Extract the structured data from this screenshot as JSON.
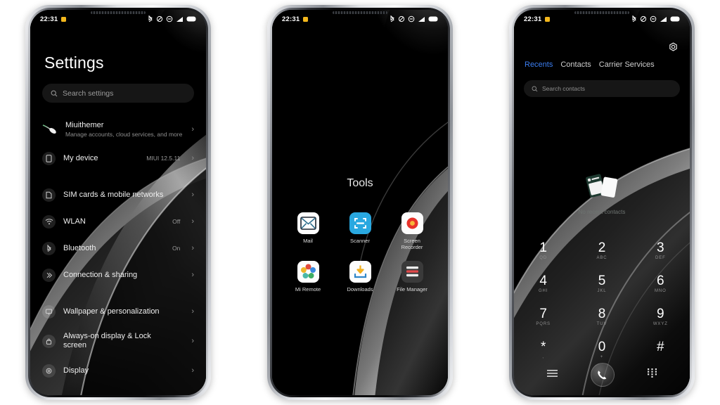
{
  "statusbar": {
    "time": "22:31",
    "icons": [
      "bluetooth-icon",
      "vibrate-off-icon",
      "dnd-icon",
      "signal-icon",
      "battery-icon"
    ]
  },
  "phone1": {
    "name": "settings-screen",
    "title": "Settings",
    "search": {
      "placeholder": "Search settings",
      "icon": "search-icon"
    },
    "account": {
      "name": "Miuithemer",
      "subtitle": "Manage accounts, cloud services, and more",
      "icon": "comet-avatar-icon",
      "chevron": "›"
    },
    "items": [
      {
        "label": "My device",
        "value": "MIUI 12.5.11",
        "icon": "phone-icon",
        "chevron": "›"
      },
      {
        "label": "SIM cards & mobile networks",
        "value": "",
        "icon": "sim-icon",
        "chevron": "›"
      },
      {
        "label": "WLAN",
        "value": "Off",
        "icon": "wifi-icon",
        "chevron": "›"
      },
      {
        "label": "Bluetooth",
        "value": "On",
        "icon": "bluetooth-icon",
        "chevron": "›"
      },
      {
        "label": "Connection & sharing",
        "value": "",
        "icon": "sharing-icon",
        "chevron": "›"
      },
      {
        "label": "Wallpaper & personalization",
        "value": "",
        "icon": "wallpaper-icon",
        "chevron": "›"
      },
      {
        "label": "Always-on display & Lock screen",
        "value": "",
        "icon": "lock-icon",
        "chevron": "›"
      },
      {
        "label": "Display",
        "value": "",
        "icon": "display-icon",
        "chevron": "›"
      }
    ]
  },
  "phone2": {
    "name": "tools-folder-screen",
    "folder_title": "Tools",
    "apps": [
      {
        "label": "Mail",
        "icon": "mail-icon"
      },
      {
        "label": "Scanner",
        "icon": "scanner-icon"
      },
      {
        "label": "Screen Recorder",
        "icon": "screen-recorder-icon"
      },
      {
        "label": "Mi Remote",
        "icon": "mi-remote-icon"
      },
      {
        "label": "Downloads",
        "icon": "downloads-icon"
      },
      {
        "label": "File Manager",
        "icon": "file-manager-icon"
      }
    ]
  },
  "phone3": {
    "name": "dialer-screen",
    "gear_icon": "gear-icon",
    "tabs": [
      {
        "label": "Recents",
        "active": true
      },
      {
        "label": "Contacts",
        "active": false
      },
      {
        "label": "Carrier Services",
        "active": false
      }
    ],
    "search": {
      "placeholder": "Search contacts",
      "icon": "search-icon"
    },
    "empty_state": {
      "text": "No recent contacts",
      "icon": "contact-cards-icon"
    },
    "keypad": [
      {
        "num": "1",
        "letters": "QD"
      },
      {
        "num": "2",
        "letters": "ABC"
      },
      {
        "num": "3",
        "letters": "DEF"
      },
      {
        "num": "4",
        "letters": "GHI"
      },
      {
        "num": "5",
        "letters": "JKL"
      },
      {
        "num": "6",
        "letters": "MNO"
      },
      {
        "num": "7",
        "letters": "PQRS"
      },
      {
        "num": "8",
        "letters": "TUV"
      },
      {
        "num": "9",
        "letters": "WXYZ"
      },
      {
        "num": "*",
        "letters": ","
      },
      {
        "num": "0",
        "letters": "+"
      },
      {
        "num": "#",
        "letters": ""
      }
    ],
    "bottom_bar": {
      "menu_icon": "menu-icon",
      "call_icon": "call-icon",
      "keypad_icon": "keypad-icon"
    }
  },
  "colors": {
    "accent": "#3b7df0",
    "status_dot": "#f3b71c",
    "scanner_blue": "#29a8e0",
    "record_red": "#e8322a",
    "download_yellow": "#f2b01e",
    "screen_bg": "#000000",
    "page_bg": "#ffffff"
  }
}
